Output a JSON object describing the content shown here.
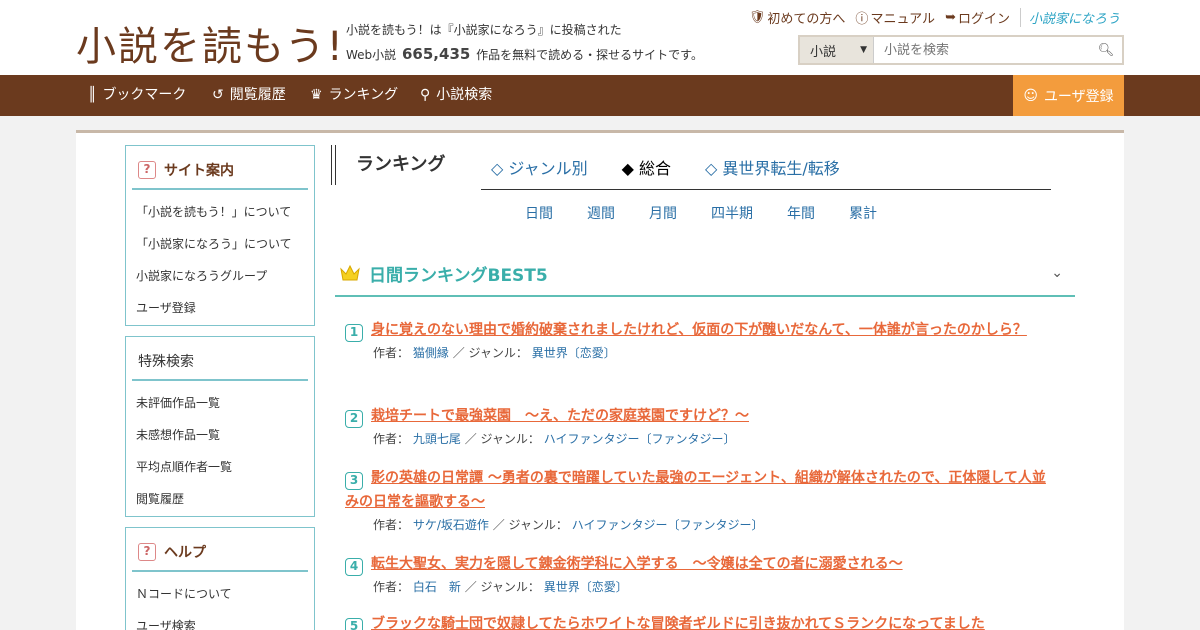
{
  "header": {
    "logo": "小説を読もう!",
    "tagline_line1": "小説を読もう！は『小説家になろう』に投稿された",
    "tagline_prefix": "Web小説",
    "tagline_count": "665,435",
    "tagline_suffix": "作品を無料で読める・探せるサイトです。",
    "links": {
      "beginner": "初めての方へ",
      "manual": "マニュアル",
      "login": "ログイン",
      "brand": "小説家になろう"
    },
    "search": {
      "select_value": "小説",
      "placeholder": "小説を検索"
    }
  },
  "nav": {
    "bookmark": "ブックマーク",
    "history": "閲覧履歴",
    "ranking": "ランキング",
    "search": "小説検索",
    "register": "ユーザ登録"
  },
  "sidebar": {
    "site_guide": {
      "title": "サイト案内",
      "items": [
        "「小説を読もう！」について",
        "「小説家になろう」について",
        "小説家になろうグループ",
        "ユーザ登録"
      ]
    },
    "special_search": {
      "title": "特殊検索",
      "items": [
        "未評価作品一覧",
        "未感想作品一覧",
        "平均点順作者一覧",
        "閲覧履歴"
      ]
    },
    "help": {
      "title": "ヘルプ",
      "items": [
        "Ｎコードについて",
        "ユーザ検索"
      ]
    }
  },
  "main": {
    "heading": "ランキング",
    "tabs": [
      "◇ ジャンル別",
      "◆ 総合",
      "◇ 異世界転生/転移"
    ],
    "periods": [
      "日間",
      "週間",
      "月間",
      "四半期",
      "年間",
      "累計"
    ],
    "best_title": "日間ランキングBEST5",
    "author_label": "作者：",
    "genre_label": "／ ジャンル：",
    "items": [
      {
        "rank": "1",
        "title": "身に覚えのない理由で婚約破棄されましたけれど、仮面の下が醜いだなんて、一体誰が言ったのかしら？",
        "author": "猫側縁",
        "genre": "異世界〔恋愛〕"
      },
      {
        "rank": "2",
        "title": "栽培チートで最強菜園　～え、ただの家庭菜園ですけど？～",
        "author": "九頭七尾",
        "genre": "ハイファンタジー〔ファンタジー〕"
      },
      {
        "rank": "3",
        "title": "影の英雄の日常譚 ～勇者の裏で暗躍していた最強のエージェント、組織が解体されたので、正体隠して人並みの日常を謳歌する～",
        "author": "サケ/坂石遊作",
        "genre": "ハイファンタジー〔ファンタジー〕"
      },
      {
        "rank": "4",
        "title": "転生大聖女、実力を隠して錬金術学科に入学する　～令嬢は全ての者に溺愛される～",
        "author": "白石　新",
        "genre": "異世界〔恋愛〕"
      },
      {
        "rank": "5",
        "title": "ブラックな騎士団で奴隷してたらホワイトな冒険者ギルドに引き抜かれてＳランクになってました",
        "author": "",
        "genre": ""
      }
    ]
  },
  "colors": {
    "brand_brown": "#6b3a1e",
    "accent_orange": "#f39c3d",
    "teal": "#3aaeaa",
    "title_orange": "#e8683a",
    "link_blue": "#2a6fa6"
  }
}
